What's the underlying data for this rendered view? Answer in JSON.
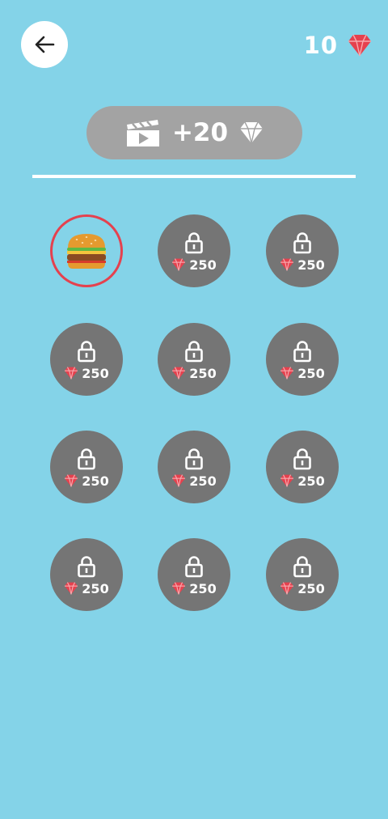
{
  "header": {
    "back_icon": "arrow-left-icon",
    "gem_count": "10",
    "gem_icon": "gem-icon",
    "gem_color": "#e5414e"
  },
  "ad_button": {
    "icon": "video-play-icon",
    "label": "+20",
    "gem_icon": "gem-icon"
  },
  "colors": {
    "background": "#84d3e8",
    "locked_circle": "#757575",
    "selected_ring": "#e5414e",
    "ad_button": "#a3a3a3"
  },
  "skins": [
    {
      "state": "unlocked",
      "icon": "burger-icon",
      "selected": true
    },
    {
      "state": "locked",
      "icon": "lock-icon",
      "price": "250"
    },
    {
      "state": "locked",
      "icon": "lock-icon",
      "price": "250"
    },
    {
      "state": "locked",
      "icon": "lock-icon",
      "price": "250"
    },
    {
      "state": "locked",
      "icon": "lock-icon",
      "price": "250"
    },
    {
      "state": "locked",
      "icon": "lock-icon",
      "price": "250"
    },
    {
      "state": "locked",
      "icon": "lock-icon",
      "price": "250"
    },
    {
      "state": "locked",
      "icon": "lock-icon",
      "price": "250"
    },
    {
      "state": "locked",
      "icon": "lock-icon",
      "price": "250"
    },
    {
      "state": "locked",
      "icon": "lock-icon",
      "price": "250"
    },
    {
      "state": "locked",
      "icon": "lock-icon",
      "price": "250"
    },
    {
      "state": "locked",
      "icon": "lock-icon",
      "price": "250"
    }
  ]
}
